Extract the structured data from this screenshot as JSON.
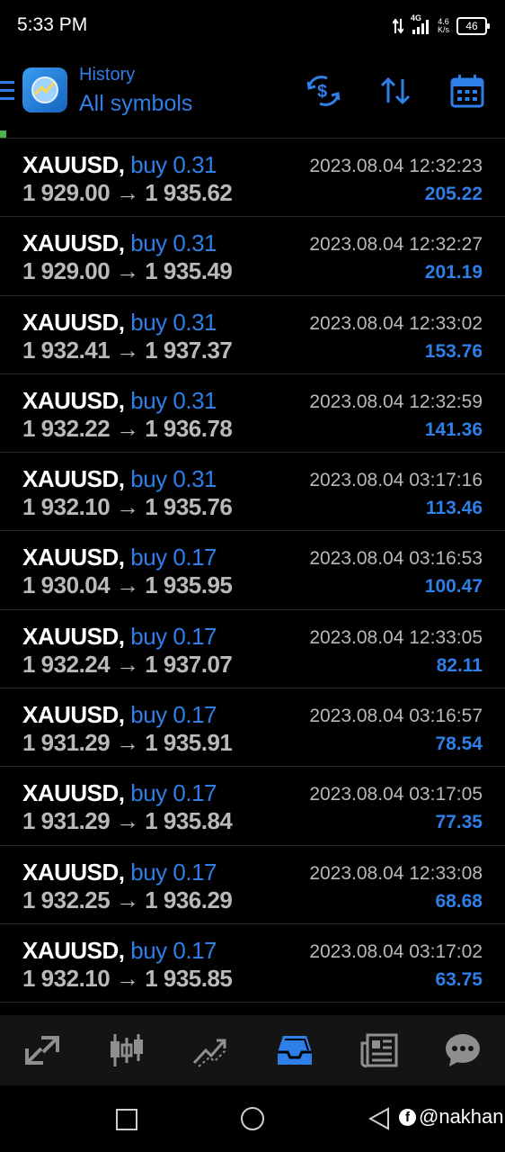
{
  "status_bar": {
    "time": "5:33 PM",
    "network": "4G",
    "speed": "4.6",
    "speed_unit": "K/s",
    "battery": "46"
  },
  "header": {
    "subtitle": "History",
    "title": "All symbols"
  },
  "accent_color": "#2e7fe8",
  "trades": [
    {
      "symbol": "XAUUSD,",
      "type": "buy 0.31",
      "date": "2023.08.04 12:32:23",
      "open": "1 929.00",
      "close": "1 935.62",
      "profit": "205.22"
    },
    {
      "symbol": "XAUUSD,",
      "type": "buy 0.31",
      "date": "2023.08.04 12:32:27",
      "open": "1 929.00",
      "close": "1 935.49",
      "profit": "201.19"
    },
    {
      "symbol": "XAUUSD,",
      "type": "buy 0.31",
      "date": "2023.08.04 12:33:02",
      "open": "1 932.41",
      "close": "1 937.37",
      "profit": "153.76"
    },
    {
      "symbol": "XAUUSD,",
      "type": "buy 0.31",
      "date": "2023.08.04 12:32:59",
      "open": "1 932.22",
      "close": "1 936.78",
      "profit": "141.36"
    },
    {
      "symbol": "XAUUSD,",
      "type": "buy 0.31",
      "date": "2023.08.04 03:17:16",
      "open": "1 932.10",
      "close": "1 935.76",
      "profit": "113.46"
    },
    {
      "symbol": "XAUUSD,",
      "type": "buy 0.17",
      "date": "2023.08.04 03:16:53",
      "open": "1 930.04",
      "close": "1 935.95",
      "profit": "100.47"
    },
    {
      "symbol": "XAUUSD,",
      "type": "buy 0.17",
      "date": "2023.08.04 12:33:05",
      "open": "1 932.24",
      "close": "1 937.07",
      "profit": "82.11"
    },
    {
      "symbol": "XAUUSD,",
      "type": "buy 0.17",
      "date": "2023.08.04 03:16:57",
      "open": "1 931.29",
      "close": "1 935.91",
      "profit": "78.54"
    },
    {
      "symbol": "XAUUSD,",
      "type": "buy 0.17",
      "date": "2023.08.04 03:17:05",
      "open": "1 931.29",
      "close": "1 935.84",
      "profit": "77.35"
    },
    {
      "symbol": "XAUUSD,",
      "type": "buy 0.17",
      "date": "2023.08.04 12:33:08",
      "open": "1 932.25",
      "close": "1 936.29",
      "profit": "68.68"
    },
    {
      "symbol": "XAUUSD,",
      "type": "buy 0.17",
      "date": "2023.08.04 03:17:02",
      "open": "1 932.10",
      "close": "1 935.85",
      "profit": "63.75"
    }
  ],
  "price_arrow": "→",
  "tabs": [
    {
      "icon": "quotes-icon",
      "active": false
    },
    {
      "icon": "chart-icon",
      "active": false
    },
    {
      "icon": "trade-icon",
      "active": false
    },
    {
      "icon": "history-icon",
      "active": true
    },
    {
      "icon": "news-icon",
      "active": false
    },
    {
      "icon": "messages-icon",
      "active": false
    }
  ],
  "watermark": {
    "text": "@nakhan"
  }
}
